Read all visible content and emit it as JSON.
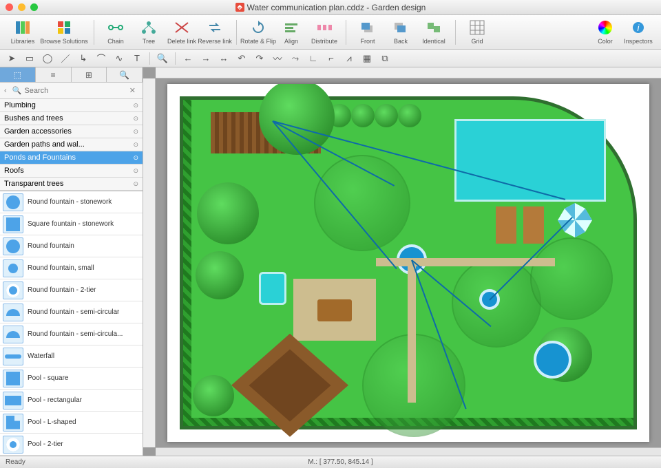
{
  "window": {
    "title": "Water communication plan.cddz - Garden design"
  },
  "toolbar": {
    "libraries": "Libraries",
    "browse": "Browse Solutions",
    "chain": "Chain",
    "tree": "Tree",
    "delete_link": "Delete link",
    "reverse_link": "Reverse link",
    "rotate": "Rotate & Flip",
    "align": "Align",
    "distribute": "Distribute",
    "front": "Front",
    "back": "Back",
    "identical": "Identical",
    "grid": "Grid",
    "color": "Color",
    "inspectors": "Inspectors"
  },
  "search": {
    "placeholder": "Search"
  },
  "categories": [
    "Plumbing",
    "Bushes and trees",
    "Garden accessories",
    "Garden paths and wal...",
    "Ponds and Fountains",
    "Roofs",
    "Transparent trees"
  ],
  "selected_category_index": 4,
  "shapes": [
    "Round fountain - stonework",
    "Square fountain - stonework",
    "Round fountain",
    "Round fountain, small",
    "Round fountain - 2-tier",
    "Round fountain - semi-circular",
    "Round fountain - semi-circula...",
    "Waterfall",
    "Pool - square",
    "Pool - rectangular",
    "Pool - L-shaped",
    "Pool - 2-tier"
  ],
  "status": {
    "ready": "Ready",
    "coords": "M.: [ 377.50, 845.14 ]"
  }
}
